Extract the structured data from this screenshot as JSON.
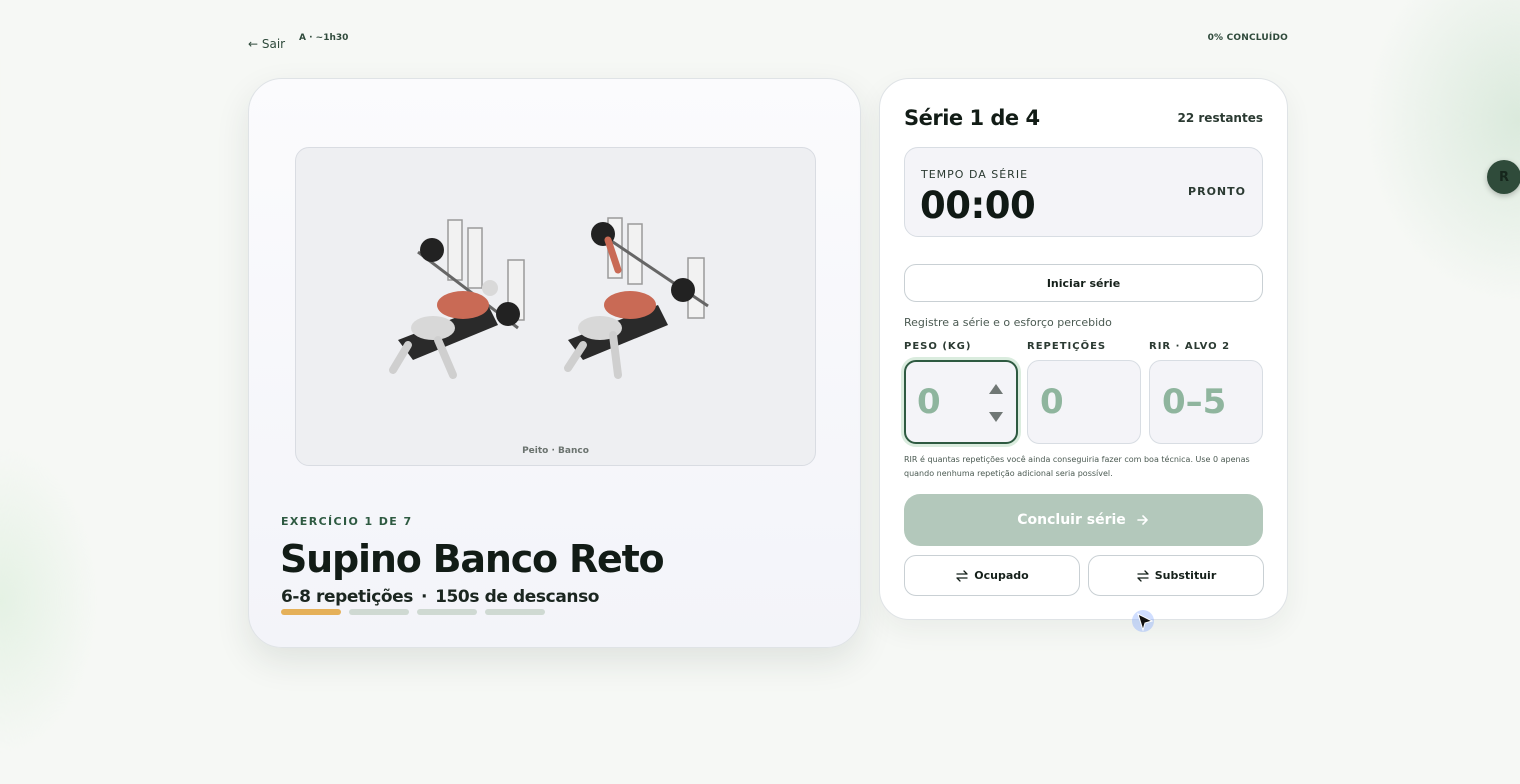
{
  "topbar": {
    "exit_label": "← Sair",
    "session_meta": "A · ~1h30",
    "progress_label": "0% CONCLUÍDO"
  },
  "exercise": {
    "media_caption": "Peito · Banco",
    "counter": "EXERCÍCIO 1 DE 7",
    "title": "Supino Banco Reto",
    "reps": "6-8 repetições",
    "separator": "·",
    "rest": "150s de descanso",
    "set_progress": {
      "total": 4,
      "current": 1
    }
  },
  "set_panel": {
    "title": "Série 1 de 4",
    "remaining": "22 restantes",
    "timer": {
      "label": "TEMPO DA SÉRIE",
      "value": "00:00",
      "status": "PRONTO"
    },
    "start_label": "Iniciar série",
    "log_hint": "Registre a série e o esforço percebido",
    "fields": {
      "weight": {
        "label": "PESO (KG)",
        "placeholder": "0"
      },
      "reps": {
        "label": "REPETIÇÕES",
        "placeholder": "0"
      },
      "rir": {
        "label": "RIR · ALVO 2",
        "placeholder": "0–5"
      }
    },
    "rir_note": "RIR é quantas repetições você ainda conseguiria fazer com boa técnica. Use 0 apenas quando nenhuma repetição adicional seria possível.",
    "finish_label": "Concluir série",
    "busy_label": "Ocupado",
    "substitute_label": "Substituir"
  },
  "avatar": {
    "initial": "R"
  },
  "colors": {
    "accent_dark": "#2e5a41",
    "set_dot_active": "#e5b059",
    "set_dot_inactive": "#cfd9d2",
    "finish_button": "#b3c8bb",
    "placeholder": "#8fb59e"
  },
  "icons": {
    "finish": "arrow-right-icon",
    "busy": "swap-icon",
    "substitute": "swap-icon"
  }
}
